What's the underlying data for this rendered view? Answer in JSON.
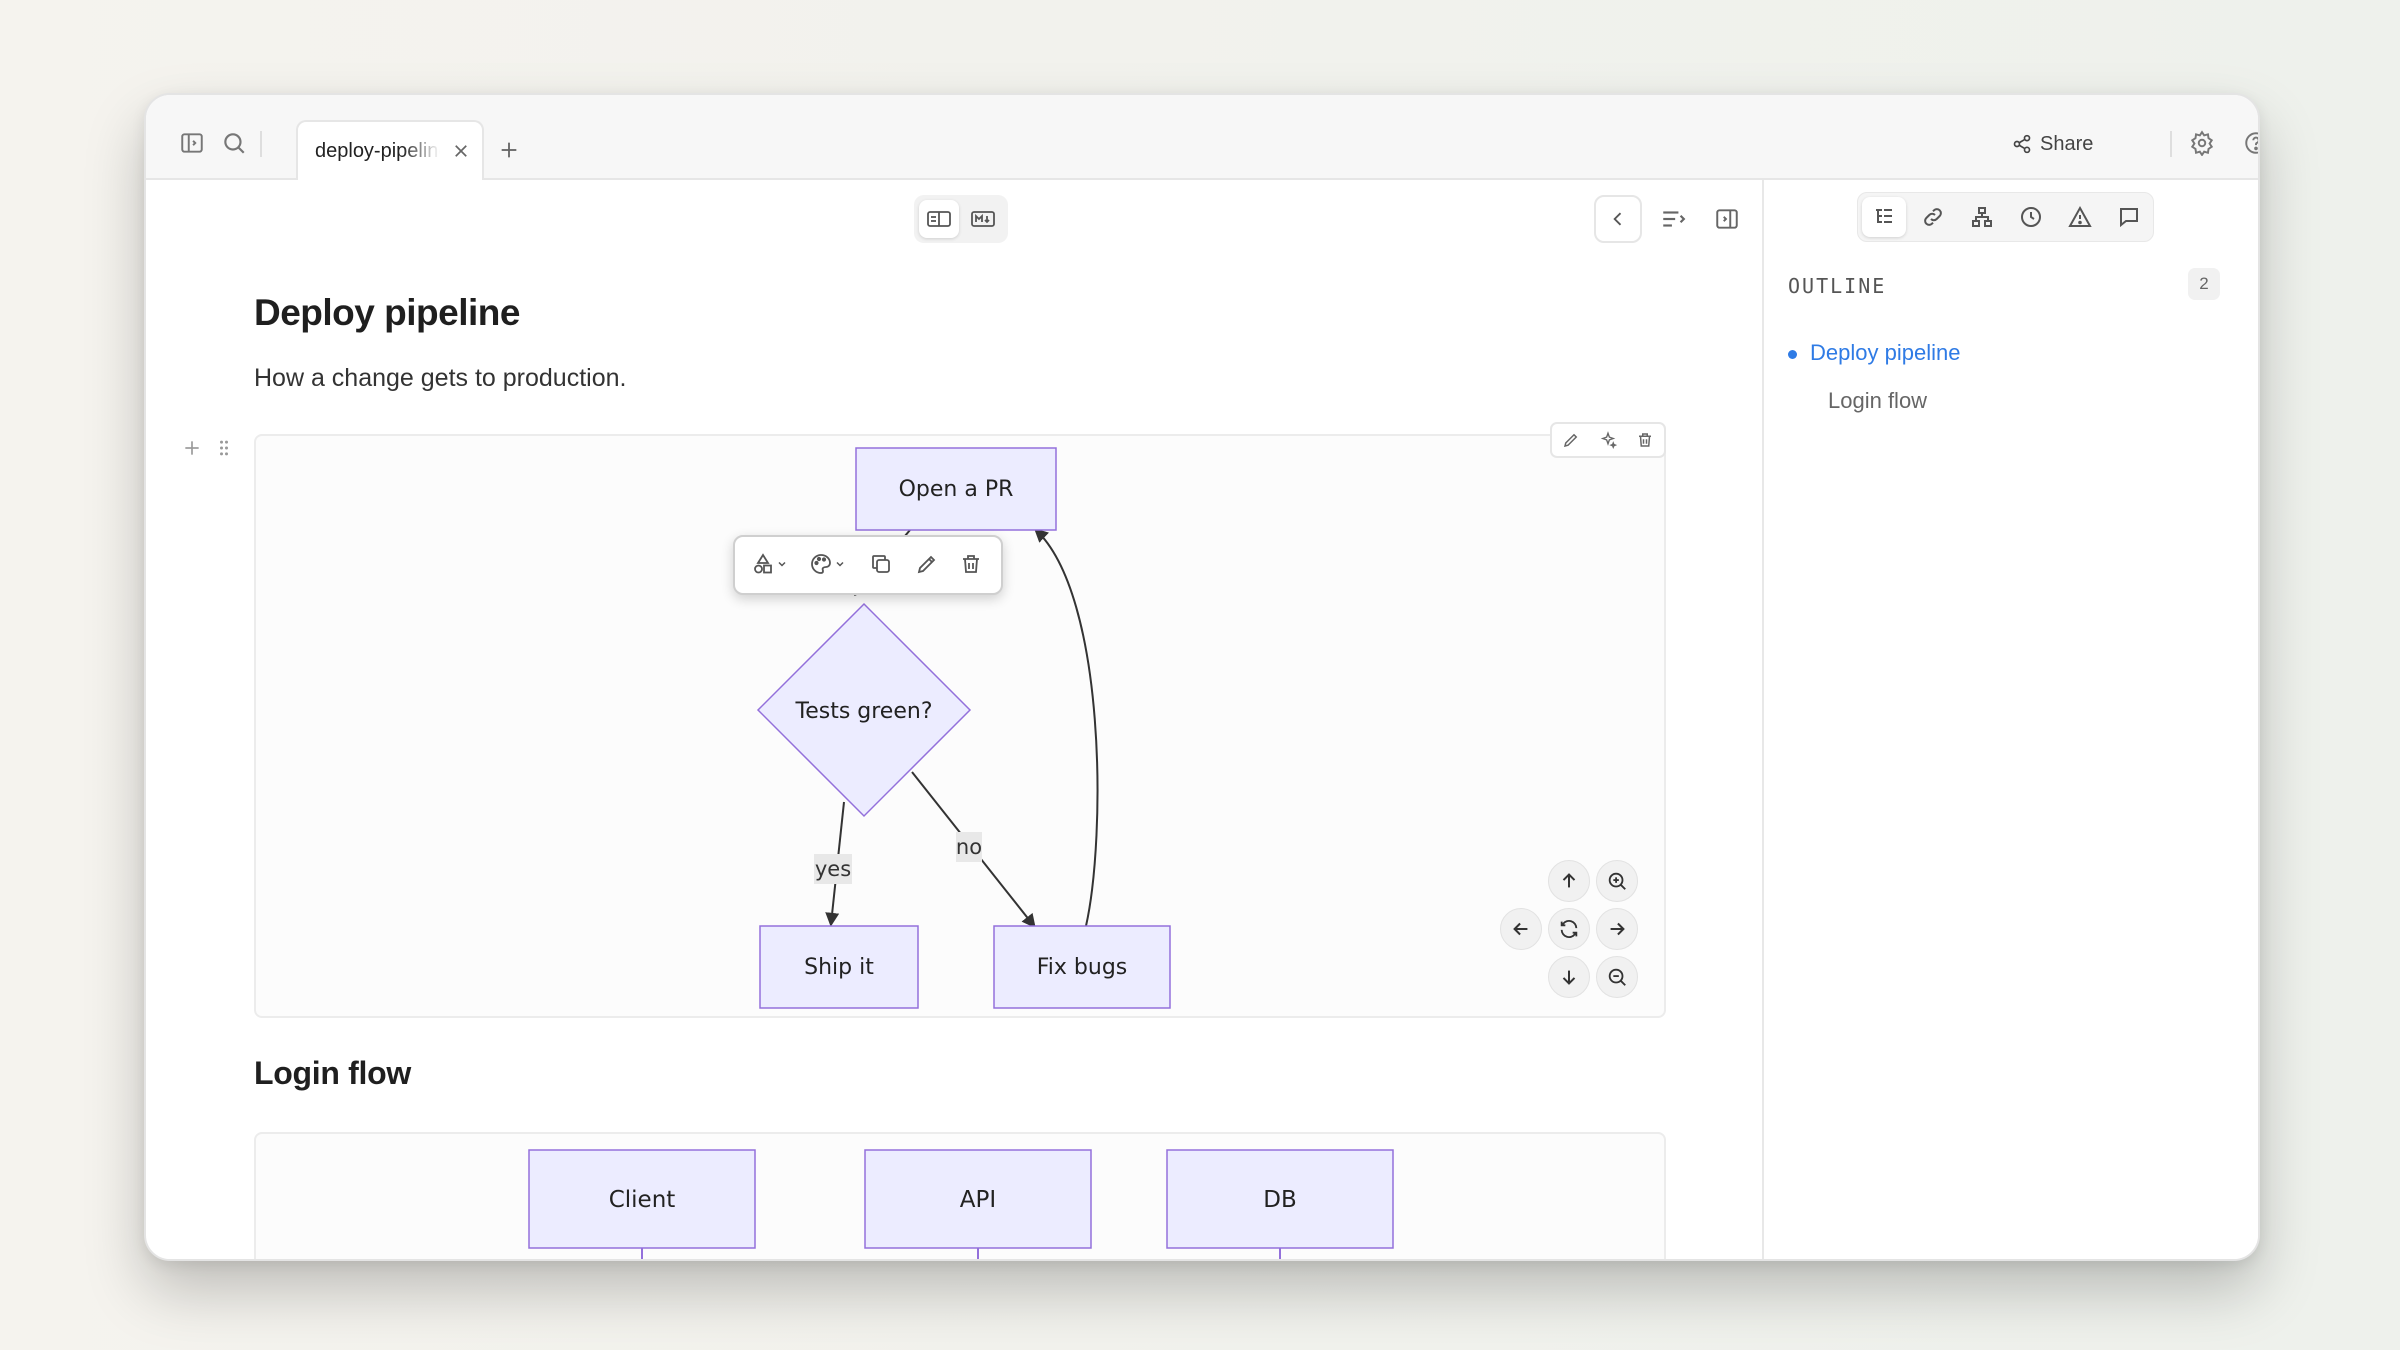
{
  "tab": {
    "title": "deploy-pipeline"
  },
  "toolbar": {
    "share_label": "Share"
  },
  "document": {
    "title": "Deploy pipeline",
    "description": "How a change gets to production.",
    "section2_title": "Login flow"
  },
  "flowchart": {
    "nodes": {
      "open_pr": "Open a PR",
      "tests": "Tests green?",
      "ship": "Ship it",
      "fix": "Fix bugs"
    },
    "edges": {
      "yes": "yes",
      "no": "no"
    }
  },
  "sequence": {
    "actors": [
      "Client",
      "API",
      "DB"
    ]
  },
  "outline": {
    "title": "OUTLINE",
    "count": "2",
    "items": [
      "Deploy pipeline",
      "Login flow"
    ]
  },
  "colors": {
    "node_fill": "#ececff",
    "node_stroke": "#9370db",
    "accent": "#2f7be5"
  },
  "icons": {
    "topbar": [
      "sidebar-toggle-icon",
      "search-icon",
      "close-icon",
      "plus-icon",
      "share-icon",
      "gear-icon",
      "help-icon"
    ],
    "sidebar_tabs": [
      "outline-icon",
      "link-icon",
      "hierarchy-icon",
      "history-icon",
      "warning-icon",
      "comment-icon"
    ]
  }
}
